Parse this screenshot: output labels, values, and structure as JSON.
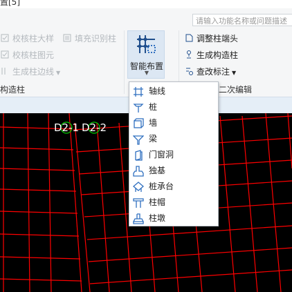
{
  "top_strip": {
    "fragment": "置[5]"
  },
  "search": {
    "placeholder": "请输入功能名称或问题描述"
  },
  "ribbon": {
    "left_group": {
      "items": [
        "校核柱大样",
        "校核柱图元",
        "生成柱边线"
      ],
      "fill_item": "填充识别柱",
      "group_label": "构造柱"
    },
    "smart_layout": {
      "label": "智能布置"
    },
    "right_group": {
      "items": [
        "调整柱端头",
        "生成构造柱",
        "查改标注"
      ],
      "group_label": "二次编辑"
    }
  },
  "dropdown": {
    "items": [
      {
        "label": "轴线",
        "icon": "axis-grid-icon"
      },
      {
        "label": "桩",
        "icon": "pile-icon"
      },
      {
        "label": "墙",
        "icon": "wall-icon"
      },
      {
        "label": "梁",
        "icon": "beam-icon"
      },
      {
        "label": "门窗洞",
        "icon": "door-window-icon"
      },
      {
        "label": "独基",
        "icon": "isolated-footing-icon"
      },
      {
        "label": "桩承台",
        "icon": "pile-cap-icon"
      },
      {
        "label": "柱帽",
        "icon": "column-cap-icon"
      },
      {
        "label": "柱墩",
        "icon": "column-pier-icon"
      }
    ]
  },
  "canvas": {
    "annotations": [
      "D2-1",
      "D2-2"
    ],
    "colors": {
      "background": "#000000",
      "grid": "#ff0000",
      "marker": "#00cc00",
      "text": "#ffffff"
    }
  },
  "colors": {
    "accent": "#2f6fbf",
    "ribbon_bg": "#f5f6f7",
    "selected_bg": "#dce7f3"
  }
}
